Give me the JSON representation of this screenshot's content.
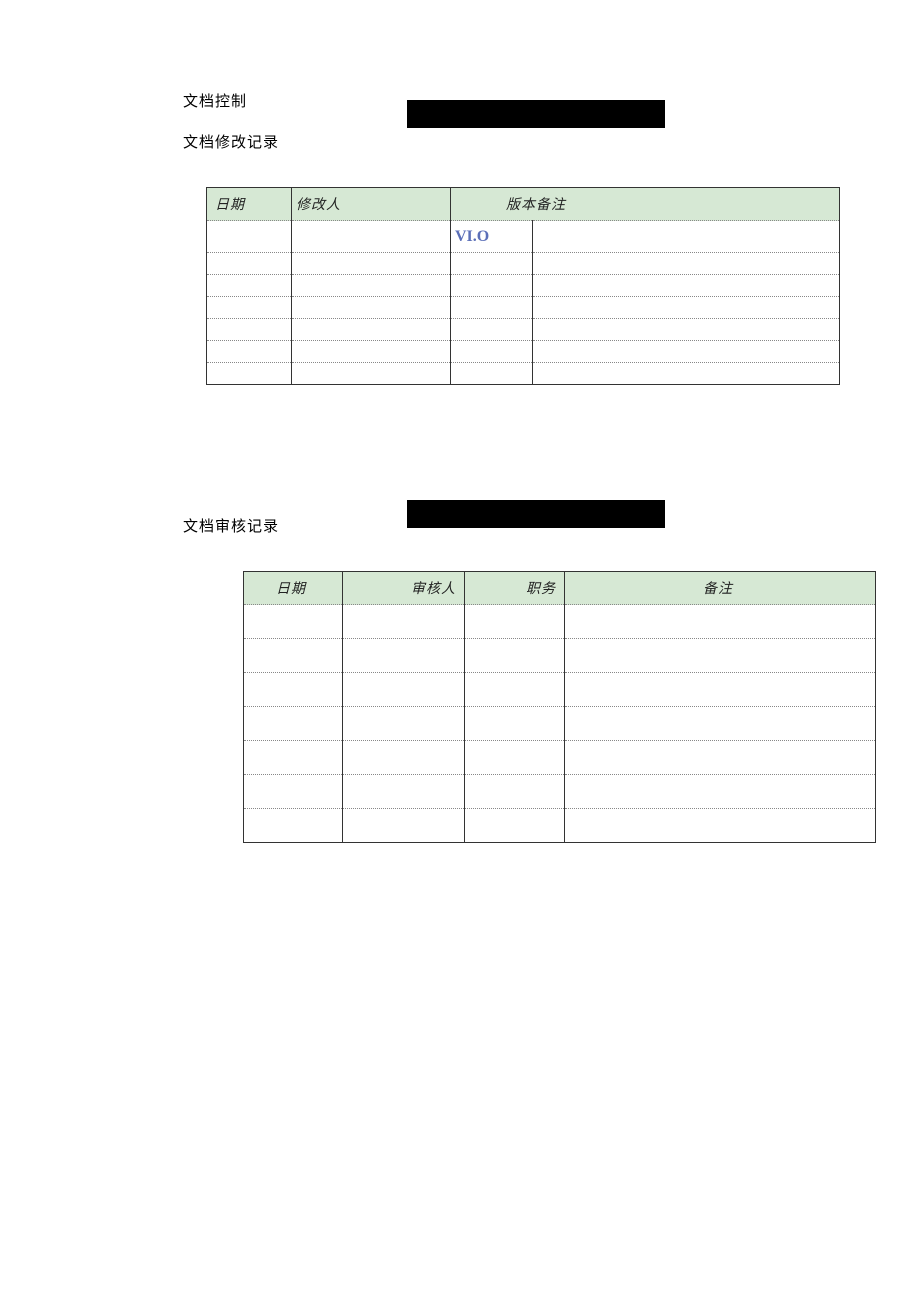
{
  "headings": {
    "doc_control": "文档控制",
    "doc_mod_record": "文档修改记录",
    "doc_review_record": "文档审核记录"
  },
  "table1": {
    "headers": {
      "date": "日期",
      "modifier": "修改人",
      "version_remark": "版本备注"
    },
    "rows": [
      {
        "date": "",
        "modifier": "",
        "version": "VI.O",
        "remark": ""
      },
      {
        "date": "",
        "modifier": "",
        "version": "",
        "remark": ""
      },
      {
        "date": "",
        "modifier": "",
        "version": "",
        "remark": ""
      },
      {
        "date": "",
        "modifier": "",
        "version": "",
        "remark": ""
      },
      {
        "date": "",
        "modifier": "",
        "version": "",
        "remark": ""
      },
      {
        "date": "",
        "modifier": "",
        "version": "",
        "remark": ""
      },
      {
        "date": "",
        "modifier": "",
        "version": "",
        "remark": ""
      }
    ]
  },
  "table2": {
    "headers": {
      "date": "日期",
      "reviewer": "审核人",
      "position": "职务",
      "remark": "备注"
    },
    "rows": [
      {
        "date": "",
        "reviewer": "",
        "position": "",
        "remark": ""
      },
      {
        "date": "",
        "reviewer": "",
        "position": "",
        "remark": ""
      },
      {
        "date": "",
        "reviewer": "",
        "position": "",
        "remark": ""
      },
      {
        "date": "",
        "reviewer": "",
        "position": "",
        "remark": ""
      },
      {
        "date": "",
        "reviewer": "",
        "position": "",
        "remark": ""
      },
      {
        "date": "",
        "reviewer": "",
        "position": "",
        "remark": ""
      },
      {
        "date": "",
        "reviewer": "",
        "position": "",
        "remark": ""
      }
    ]
  }
}
